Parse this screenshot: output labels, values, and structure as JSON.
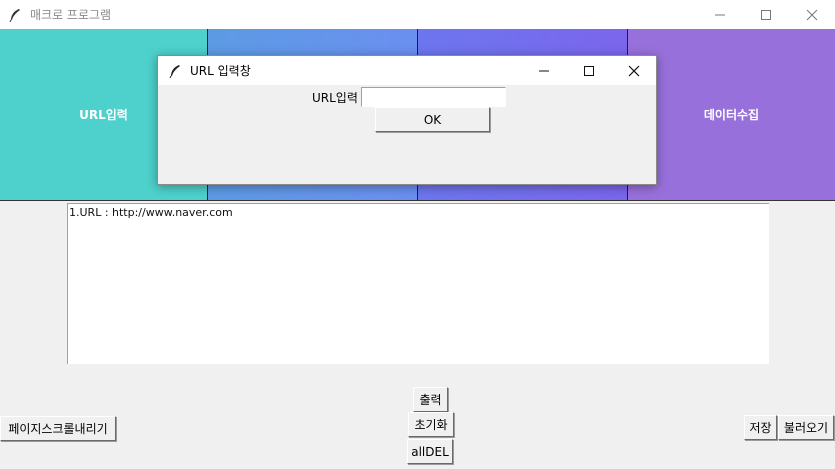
{
  "window": {
    "title": "매크로 프로그램",
    "minimize_glyph": "—",
    "maximize_glyph": "☐",
    "close_glyph": "✕"
  },
  "panels": [
    {
      "label": "URL입력",
      "color": "#4ed1cc"
    },
    {
      "label": "",
      "color": "#6493ea"
    },
    {
      "label": "",
      "color": "#766ced"
    },
    {
      "label": "데이터수집",
      "color": "#9870db"
    }
  ],
  "textarea": {
    "content": "1.URL : http://www.naver.com"
  },
  "buttons": {
    "output": "출력",
    "reset": "초기화",
    "alldel": "allDEL",
    "scroll_down": "페이지스크롤내리기",
    "save": "저장",
    "load": "불러오기"
  },
  "dialog": {
    "title": "URL 입력창",
    "label": "URL입력",
    "input_value": "",
    "input_placeholder": "",
    "ok_label": "OK"
  },
  "icons": {
    "app": "feather-icon"
  }
}
